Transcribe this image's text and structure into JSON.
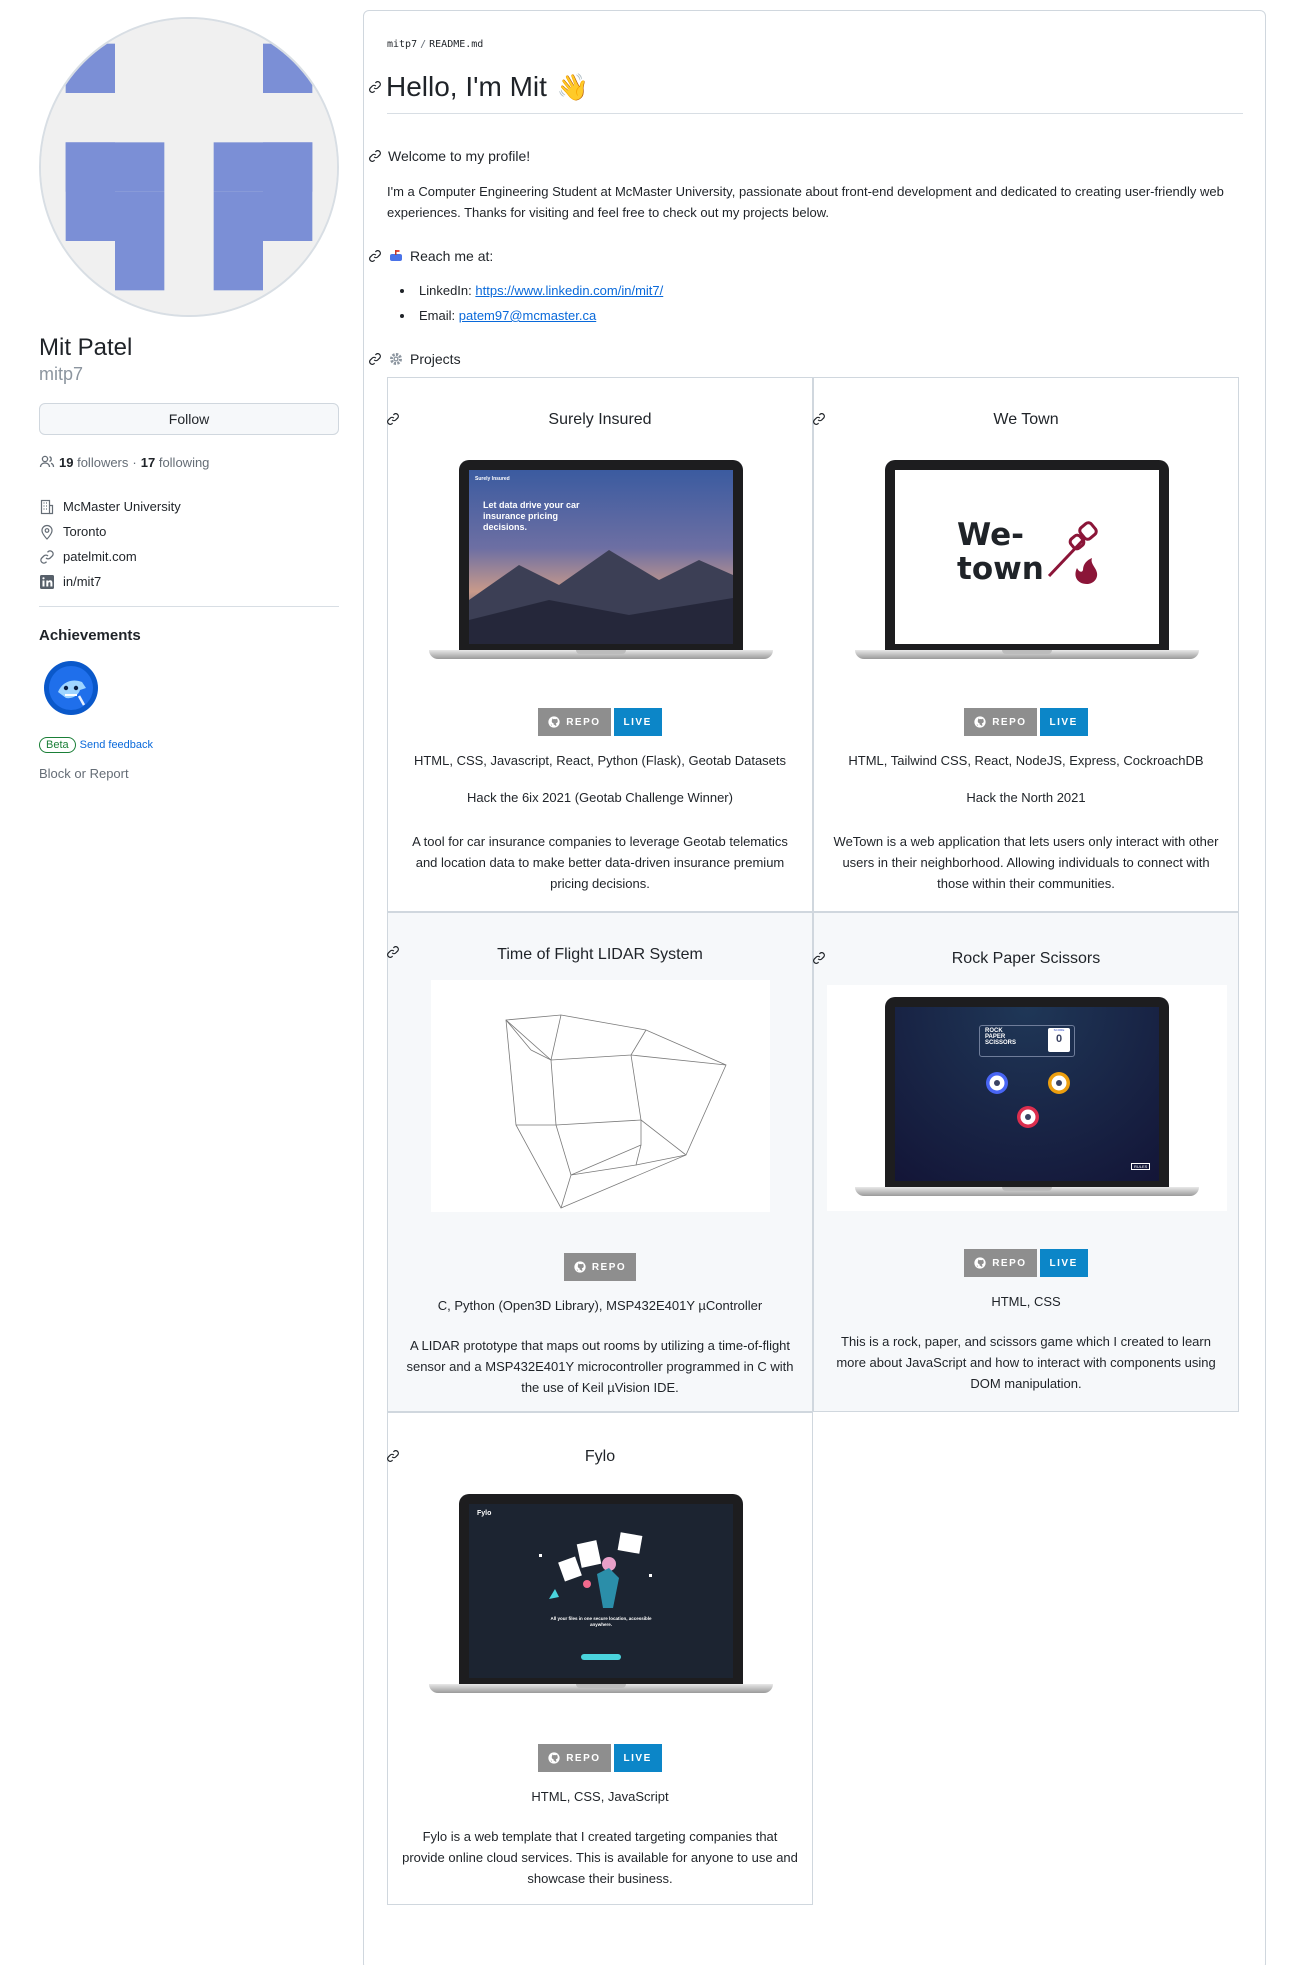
{
  "profile": {
    "name": "Mit Patel",
    "login": "mitp7",
    "follow_label": "Follow",
    "followers_count": "19",
    "followers_label": "followers",
    "separator": "·",
    "following_count": "17",
    "following_label": "following",
    "organization": "McMaster University",
    "location": "Toronto",
    "website": "patelmit.com",
    "linkedin": "in/mit7",
    "achievements_title": "Achievements",
    "beta_label": "Beta",
    "feedback_label": "Send feedback",
    "block_label": "Block or Report"
  },
  "readme": {
    "breadcrumb_user": "mitp7",
    "breadcrumb_sep": "/",
    "breadcrumb_file": "README.md",
    "heading": "Hello, I'm Mit",
    "wave_emoji": "👋",
    "welcome": "Welcome to my profile!",
    "intro": "I'm a Computer Engineering Student at McMaster University, passionate about front-end development and dedicated to creating user-friendly web experiences. Thanks for visiting and feel free to check out my projects below.",
    "reach_title": "Reach me at:",
    "linkedin_label": "LinkedIn:",
    "linkedin_url": "https://www.linkedin.com/in/mit7/",
    "email_label": "Email:",
    "email": "patem97@mcmaster.ca",
    "projects_title": "Projects"
  },
  "buttons": {
    "repo": "REPO",
    "live": "LIVE"
  },
  "projects": [
    {
      "title": "Surely Insured",
      "tech": "HTML, CSS, Javascript, React, Python (Flask), Geotab Datasets",
      "event": "Hack the 6ix 2021 (Geotab Challenge Winner)",
      "description": "A tool for car insurance companies to leverage Geotab telematics and location data to make better data-driven insurance premium pricing decisions.",
      "screen_brand": "Surely Insured",
      "screen_headline": "Let data drive your car insurance pricing decisions."
    },
    {
      "title": "We Town",
      "tech": "HTML, Tailwind CSS, React, NodeJS, Express, CockroachDB",
      "event": "Hack the North 2021",
      "description": "WeTown is a web application that lets users only interact with other users in their neighborhood. Allowing individuals to connect with those within their communities.",
      "logo_line1": "We-",
      "logo_line2": "town"
    },
    {
      "title": "Time of Flight LIDAR System",
      "tech": "C, Python (Open3D Library), MSP432E401Y µController",
      "description": "A LIDAR prototype that maps out rooms by utilizing a time-of-flight sensor and a MSP432E401Y microcontroller programmed in C with the use of Keil µVision IDE."
    },
    {
      "title": "Rock Paper Scissors",
      "tech": "HTML, CSS",
      "description": "This is a rock, paper, and scissors game which I created to learn more about JavaScript and how to interact with components using DOM manipulation.",
      "screen_title_1": "ROCK",
      "screen_title_2": "PAPER",
      "screen_title_3": "SCISSORS",
      "score_label": "SCORE",
      "score_value": "0",
      "rules_label": "RULES"
    },
    {
      "title": "Fylo",
      "tech": "HTML, CSS, JavaScript",
      "description": "Fylo is a web template that I created targeting companies that provide online cloud services. This is available for anyone to use and showcase their business.",
      "screen_brand": "Fylo",
      "screen_headline": "All your files in one secure location, accessible anywhere."
    }
  ],
  "colors": {
    "avatar_blue": "#7b8fd6",
    "link": "#0969da",
    "repo_button": "#8e8e8e",
    "live_button": "#0c86c8",
    "wetown_logo": "#8b1538"
  }
}
